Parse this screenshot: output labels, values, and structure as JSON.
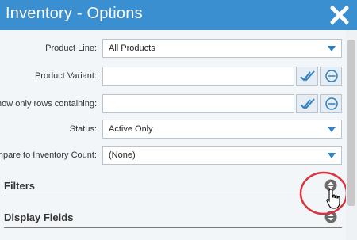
{
  "window": {
    "title": "Inventory - Options",
    "close_icon": "close-icon"
  },
  "fields": {
    "product_line": {
      "label": "Product Line:",
      "value": "All Products"
    },
    "product_variant": {
      "label": "Product Variant:",
      "value": "",
      "select_all_icon": "double-check-icon",
      "clear_icon": "minus-circle-icon"
    },
    "show_only_rows": {
      "label": "Show only rows containing:",
      "value": "",
      "select_all_icon": "double-check-icon",
      "clear_icon": "minus-circle-icon"
    },
    "status": {
      "label": "Status:",
      "value": "Active Only"
    },
    "compare_inventory": {
      "label": "Compare to Inventory Count:",
      "value": "(None)"
    }
  },
  "sections": {
    "filters": {
      "title": "Filters",
      "icon": "expand-toggle-icon"
    },
    "display_fields": {
      "title": "Display Fields",
      "icon": "expand-toggle-icon"
    }
  },
  "colors": {
    "titlebar": "#3a8fd0",
    "accent": "#2f7fc4",
    "annotation": "#d9333f"
  }
}
